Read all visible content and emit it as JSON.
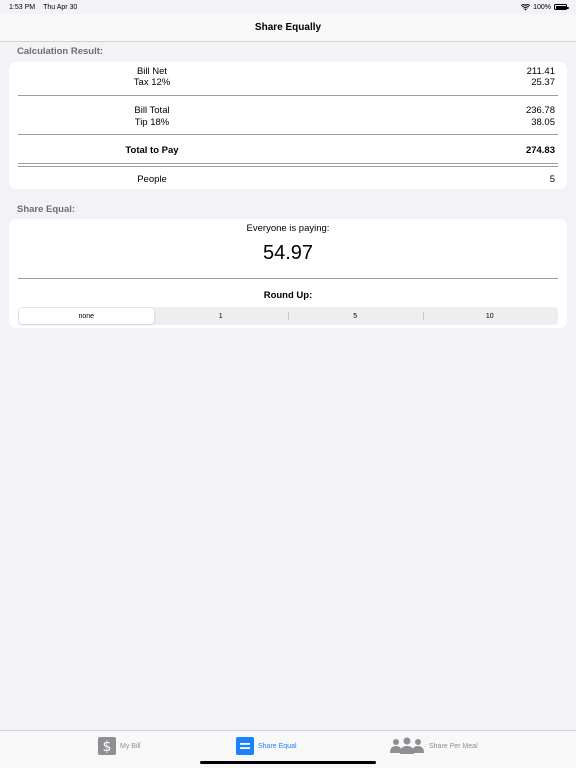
{
  "status": {
    "time": "1:53 PM",
    "date": "Thu Apr 30",
    "battery": "100%"
  },
  "nav": {
    "title": "Share Equally"
  },
  "calculation": {
    "header": "Calculation Result:",
    "bill_net_label": "Bill Net",
    "bill_net_value": "211.41",
    "tax_label": "Tax 12%",
    "tax_value": "25.37",
    "bill_total_label": "Bill Total",
    "bill_total_value": "236.78",
    "tip_label": "Tip 18%",
    "tip_value": "38.05",
    "total_label": "Total to Pay",
    "total_value": "274.83",
    "people_label": "People",
    "people_value": "5"
  },
  "share": {
    "header": "Share Equal:",
    "paying_label": "Everyone is paying:",
    "paying_value": "54.97",
    "round_up_label": "Round Up:",
    "options": [
      "none",
      "1",
      "5",
      "10"
    ],
    "selected": "none"
  },
  "tabs": [
    {
      "label": "My Bill",
      "icon": "dollar-icon"
    },
    {
      "label": "Share Equal",
      "icon": "equal-icon"
    },
    {
      "label": "Share Per Meal",
      "icon": "people-icon"
    }
  ],
  "colors": {
    "accent": "#1a82fb",
    "inactive": "#8e8e93",
    "background": "#f2f2f7"
  }
}
